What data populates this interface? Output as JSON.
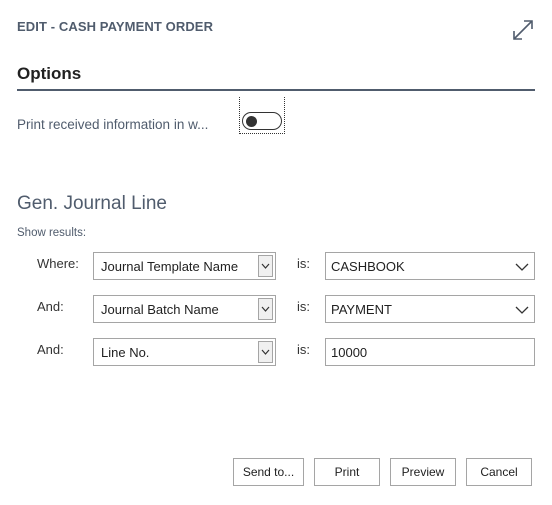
{
  "dialog": {
    "title": "EDIT - CASH PAYMENT ORDER"
  },
  "options": {
    "title": "Options",
    "print_received_label": "Print received information in w...",
    "print_received_enabled": false
  },
  "filter": {
    "title": "Gen. Journal Line",
    "show_results": "Show results:",
    "rows": [
      {
        "label": "Where:",
        "field": "Journal Template Name",
        "operator": "is:",
        "value": "CASHBOOK"
      },
      {
        "label": "And:",
        "field": "Journal Batch Name",
        "operator": "is:",
        "value": "PAYMENT"
      },
      {
        "label": "And:",
        "field": "Line No.",
        "operator": "is:",
        "value": "10000"
      }
    ]
  },
  "buttons": {
    "send_to": "Send to...",
    "print": "Print",
    "preview": "Preview",
    "cancel": "Cancel"
  },
  "icons": {
    "expand": "expand-diagonal-icon",
    "dropdown": "chevron-down-icon"
  }
}
